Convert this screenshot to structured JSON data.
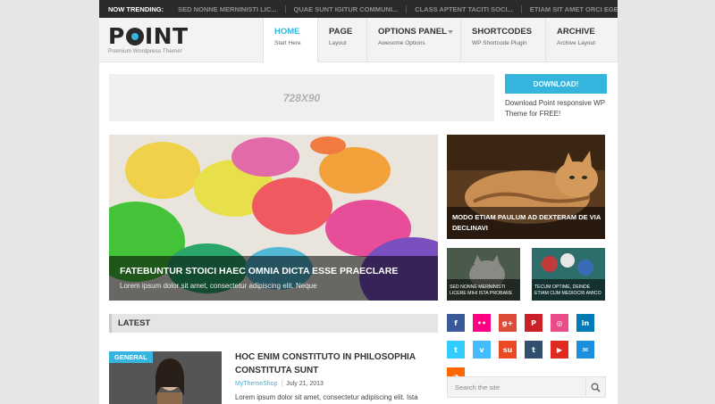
{
  "trending": {
    "label": "NOW TRENDING:",
    "items": [
      "SED NONNE MERNINISTI LIC...",
      "QUAE SUNT IGITUR COMMUNI...",
      "CLASS APTENT TACITI SOCI...",
      "ETIAM SIT AMET ORCI EGET..."
    ]
  },
  "brand": {
    "logo_left": "P",
    "logo_right": "INT",
    "tagline": "Premium Wordpress Theme!"
  },
  "nav": [
    {
      "title": "HOME",
      "sub": "Start Here"
    },
    {
      "title": "PAGE",
      "sub": "Layout"
    },
    {
      "title": "OPTIONS PANEL",
      "sub": "Awesome Options"
    },
    {
      "title": "SHORTCODES",
      "sub": "WP Shortcode Plugin"
    },
    {
      "title": "ARCHIVE",
      "sub": "Archive Layout"
    }
  ],
  "ad": {
    "label": "728X90"
  },
  "download": {
    "button": "DOWNLOAD!",
    "text": "Download Point responsive WP Theme for FREE!"
  },
  "featured": {
    "big": {
      "title": "FATEBUNTUR STOICI HAEC OMNIA DICTA ESSE PRAECLARE",
      "desc": "Lorem ipsum dolor sit amet, consectetur adipiscing elit. Neque"
    },
    "cat": {
      "title": "MODO ETIAM PAULUM AD DEXTERAM DE VIA DECLINAVI"
    },
    "small1": {
      "title": "SED NONNE MERNINISTI LICERE MIHI ISTA PROBARE"
    },
    "small2": {
      "title": "TECUM OPTIME, DEINDE ETIAM CUM MEDIOCRI AMICO"
    }
  },
  "latest": {
    "heading": "LATEST",
    "post": {
      "category": "GENERAL",
      "title": "HOC ENIM CONSTITUTO IN PHILOSOPHIA CONSTITUTA SUNT",
      "author": "MyThemeShop",
      "date": "July 21, 2013",
      "excerpt": "Lorem ipsum dolor sit amet, consectetur adipiscing elit. Ista"
    }
  },
  "social": [
    {
      "name": "facebook-icon",
      "glyph": "f",
      "color": "#3b5998"
    },
    {
      "name": "flickr-icon",
      "glyph": "••",
      "color": "#ff0084"
    },
    {
      "name": "google-plus-icon",
      "glyph": "g+",
      "color": "#dd4b39"
    },
    {
      "name": "pinterest-icon",
      "glyph": "P",
      "color": "#cb2027"
    },
    {
      "name": "dribbble-icon",
      "glyph": "◎",
      "color": "#ea4c89"
    },
    {
      "name": "linkedin-icon",
      "glyph": "in",
      "color": "#007bb6"
    },
    {
      "name": "twitter-icon",
      "glyph": "t",
      "color": "#33ccff"
    },
    {
      "name": "vimeo-icon",
      "glyph": "v",
      "color": "#44bbff"
    },
    {
      "name": "stumbleupon-icon",
      "glyph": "su",
      "color": "#eb4924"
    },
    {
      "name": "tumblr-icon",
      "glyph": "t",
      "color": "#32506d"
    },
    {
      "name": "youtube-icon",
      "glyph": "▶",
      "color": "#e02a20"
    },
    {
      "name": "email-icon",
      "glyph": "✉",
      "color": "#1d90dd"
    },
    {
      "name": "rss-icon",
      "glyph": "◔",
      "color": "#ff6600"
    }
  ],
  "search": {
    "placeholder": "Search the site"
  },
  "colors": {
    "accent": "#35b4de",
    "dark_bar": "#2a2a2a"
  }
}
